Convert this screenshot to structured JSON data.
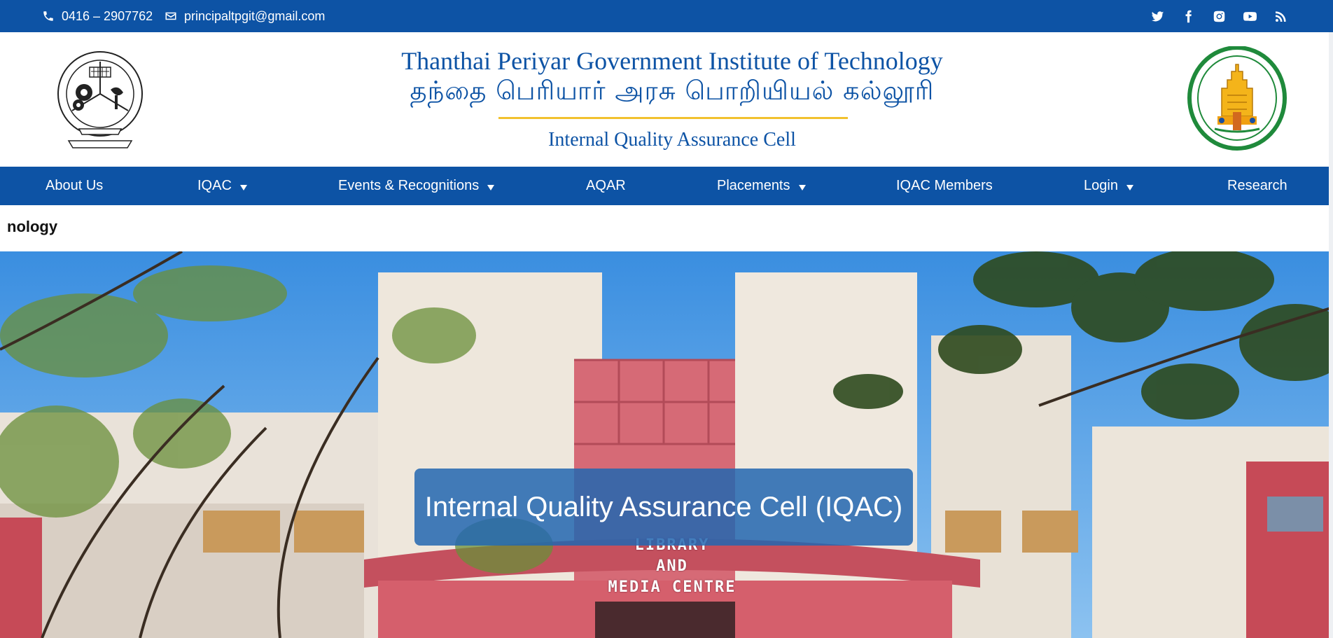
{
  "topbar": {
    "phone": "0416 – 2907762",
    "email": "principaltpgit@gmail.com",
    "social": [
      "twitter-icon",
      "facebook-icon",
      "instagram-icon",
      "youtube-icon",
      "rss-icon"
    ]
  },
  "header": {
    "title_en": "Thanthai Periyar Government Institute of Technology",
    "title_ta": "தந்தை பெரியார் அரசு பொறியியல் கல்லூரி",
    "subtitle": "Internal Quality Assurance Cell"
  },
  "nav": {
    "items": [
      {
        "label": "About Us",
        "dropdown": false
      },
      {
        "label": "IQAC",
        "dropdown": true
      },
      {
        "label": "Events & Recognitions",
        "dropdown": true
      },
      {
        "label": "AQAR",
        "dropdown": false
      },
      {
        "label": "Placements",
        "dropdown": true
      },
      {
        "label": "IQAC Members",
        "dropdown": false
      },
      {
        "label": "Login",
        "dropdown": true
      },
      {
        "label": "Research",
        "dropdown": false
      }
    ]
  },
  "ticker": {
    "text": "nology"
  },
  "hero": {
    "banner": "Internal Quality Assurance Cell (IQAC)",
    "sign_line1": "LIBRARY",
    "sign_line2": "AND",
    "sign_line3": "MEDIA CENTRE"
  },
  "colors": {
    "primary": "#0d53a5",
    "accent": "#f2c12e",
    "banner": "#2266b0"
  }
}
